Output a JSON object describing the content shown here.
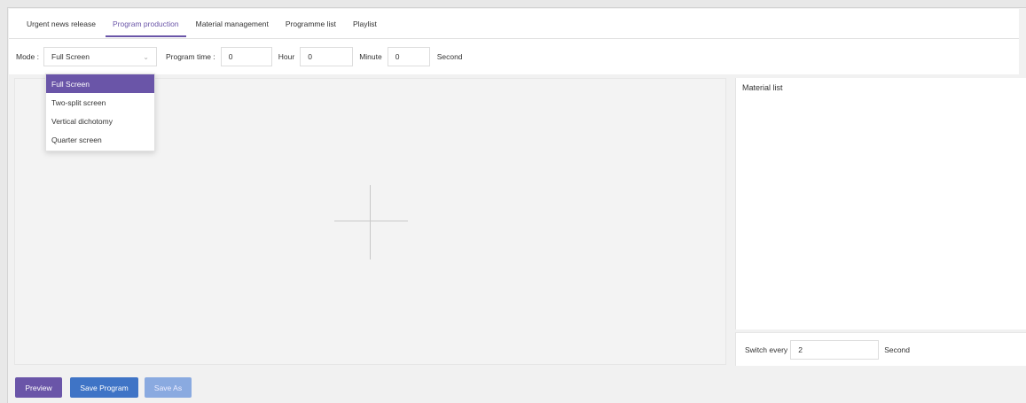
{
  "tabs": [
    {
      "label": "Urgent news release",
      "active": false
    },
    {
      "label": "Program production",
      "active": true
    },
    {
      "label": "Material management",
      "active": false
    },
    {
      "label": "Programme list",
      "active": false
    },
    {
      "label": "Playlist",
      "active": false
    }
  ],
  "toolbar": {
    "mode_label": "Mode :",
    "mode_value": "Full Screen",
    "program_time_label": "Program time :",
    "hours_value": "0",
    "hour_label": "Hour",
    "minutes_value": "0",
    "minute_label": "Minute",
    "seconds_value": "0",
    "second_label": "Second"
  },
  "mode_options": [
    {
      "label": "Full Screen",
      "selected": true
    },
    {
      "label": "Two-split screen",
      "selected": false
    },
    {
      "label": "Vertical dichotomy",
      "selected": false
    },
    {
      "label": "Quarter screen",
      "selected": false
    }
  ],
  "material_panel": {
    "title": "Material list",
    "switch_label": "Switch every",
    "switch_value": "2",
    "switch_unit": "Second"
  },
  "buttons": {
    "preview": "Preview",
    "save_program": "Save Program",
    "save_as": "Save As"
  },
  "colors": {
    "accent": "#6a55a8",
    "primary": "#3f74c6",
    "disabled": "#8aaae0"
  }
}
